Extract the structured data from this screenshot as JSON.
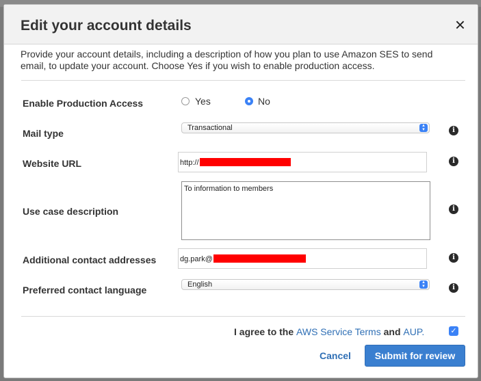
{
  "dialog": {
    "title": "Edit your account details",
    "close_label": "×",
    "intro": "Provide your account details, including a description of how you plan to use Amazon SES to send email, to update your account. Choose Yes if you wish to enable production access."
  },
  "form": {
    "production_access": {
      "label": "Enable Production Access",
      "options": [
        "Yes",
        "No"
      ],
      "selected": "No"
    },
    "mail_type": {
      "label": "Mail type",
      "value": "Transactional"
    },
    "website_url": {
      "label": "Website URL",
      "value_prefix": "http://"
    },
    "use_case": {
      "label": "Use case description",
      "value": "To information to members"
    },
    "contact_addresses": {
      "label": "Additional contact addresses",
      "value_prefix": "dg.park@"
    },
    "contact_language": {
      "label": "Preferred contact language",
      "value": "English"
    }
  },
  "footer": {
    "agree_prefix": "I agree to the",
    "terms_link": "AWS Service Terms",
    "and_text": "and",
    "aup_link": "AUP.",
    "agreed": true,
    "cancel_label": "Cancel",
    "submit_label": "Submit for review"
  },
  "icons": {
    "info": "info-icon",
    "close": "close-icon",
    "select": "chevron-updown-icon",
    "check": "checkmark-icon"
  },
  "colors": {
    "accent": "#3a7fd0",
    "link": "#2f6fb5",
    "redaction": "#ff0000"
  }
}
